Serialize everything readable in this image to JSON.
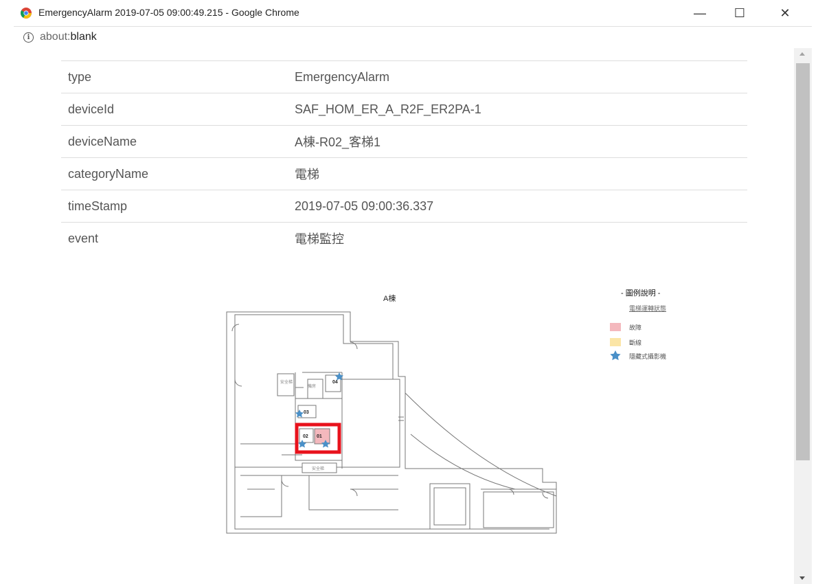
{
  "window": {
    "title": "EmergencyAlarm 2019-07-05 09:00:49.215 - Google Chrome",
    "controls": {
      "minimize": "—",
      "maximize": "☐",
      "close": "✕"
    }
  },
  "address_bar": {
    "url_prefix": "about:",
    "url_main": "blank",
    "info_icon": "i"
  },
  "details": [
    {
      "key": "type",
      "value": "EmergencyAlarm"
    },
    {
      "key": "deviceId",
      "value": "SAF_HOM_ER_A_R2F_ER2PA-1"
    },
    {
      "key": "deviceName",
      "value": "A棟-R02_客梯1"
    },
    {
      "key": "categoryName",
      "value": "電梯"
    },
    {
      "key": "timeStamp",
      "value": "2019-07-05 09:00:36.337"
    },
    {
      "key": "event",
      "value": "電梯監控"
    }
  ],
  "floorplan": {
    "title": "A棟",
    "legend": {
      "title": "- 圖例說明 -",
      "subtitle": "電梯運轉狀態",
      "items": [
        {
          "label": "故障",
          "color": "#f4b8bd",
          "icon": "swatch"
        },
        {
          "label": "斷線",
          "color": "#fbe5a6",
          "icon": "swatch"
        },
        {
          "label": "隱藏式攝影機",
          "color": "#4a90c8",
          "icon": "star-icon"
        }
      ]
    },
    "rooms": {
      "elevator_01": "01",
      "elevator_02": "02",
      "elevator_03": "03",
      "elevator_04": "04",
      "room_a": "安全梯",
      "room_b": "機房",
      "lower_room": "安全梯"
    },
    "highlight_color": "#e8121c"
  },
  "colors": {
    "scrollbar_track": "#f1f1f1",
    "scrollbar_thumb": "#c1c1c1",
    "row_border": "#dddddd"
  }
}
